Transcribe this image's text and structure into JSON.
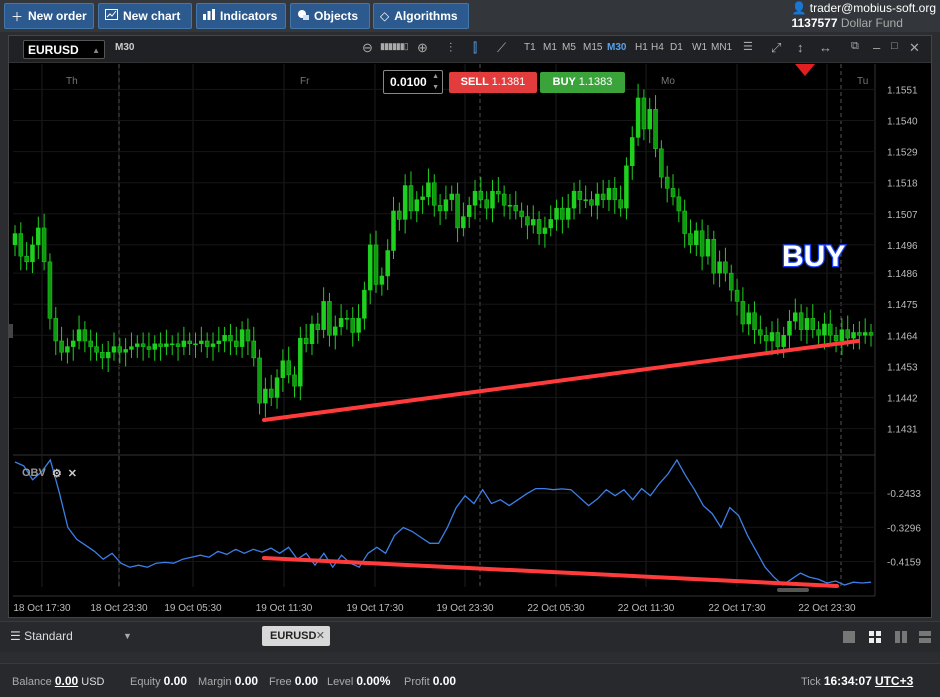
{
  "toolbar": {
    "buttons": [
      {
        "label": "New order",
        "icon": "plus-icon"
      },
      {
        "label": "New chart",
        "icon": "chart-icon"
      },
      {
        "label": "Indicators",
        "icon": "bars-icon"
      },
      {
        "label": "Objects",
        "icon": "objects-icon"
      },
      {
        "label": "Algorithms",
        "icon": "diamond-icon"
      }
    ]
  },
  "account": {
    "user": "trader@mobius-soft.org",
    "number": "1137577",
    "fund": "Dollar Fund"
  },
  "chart": {
    "symbol": "EURUSD",
    "timeframe_badge": "M30",
    "timeframes": [
      "T1",
      "M1",
      "M5",
      "M15",
      "M30",
      "H1",
      "H4",
      "D1",
      "W1",
      "MN1"
    ],
    "active_timeframe": "M30",
    "volume": "0.0100",
    "sell": {
      "label": "SELL",
      "price": "1.1381"
    },
    "buy": {
      "label": "BUY",
      "price": "1.1383"
    },
    "annotation": "BUY",
    "indicator": "OBV",
    "colors": {
      "bull": "#1fd11f",
      "bear": "#0f9a0f",
      "trendline": "#ff3b3b",
      "obv": "#3d7fe6",
      "buy_text": "#ffffff",
      "buy_glow": "#1a45ff"
    }
  },
  "chart_data": {
    "type": "candlestick",
    "price_ticks": [
      1.1551,
      1.154,
      1.1529,
      1.1518,
      1.1507,
      1.1496,
      1.1486,
      1.1475,
      1.1464,
      1.1453,
      1.1442,
      1.1431
    ],
    "obv_ticks": [
      -0.2433,
      -0.3296,
      -0.4159
    ],
    "day_labels": [
      "Th",
      "Fr",
      "Mo",
      "Tu"
    ],
    "time_labels": [
      "18 Oct 17:30",
      "18 Oct 23:30",
      "19 Oct 05:30",
      "19 Oct 11:30",
      "19 Oct 17:30",
      "19 Oct 23:30",
      "22 Oct 05:30",
      "22 Oct 11:30",
      "22 Oct 17:30",
      "22 Oct 23:30"
    ],
    "close": [
      1.15,
      1.1492,
      1.149,
      1.1496,
      1.1502,
      1.149,
      1.147,
      1.1462,
      1.1458,
      1.146,
      1.1462,
      1.1466,
      1.1462,
      1.146,
      1.1458,
      1.1456,
      1.1458,
      1.146,
      1.1458,
      1.1459,
      1.146,
      1.1461,
      1.146,
      1.1459,
      1.1461,
      1.146,
      1.1461,
      1.1461,
      1.146,
      1.1462,
      1.1461,
      1.1461,
      1.1462,
      1.146,
      1.1461,
      1.1462,
      1.1464,
      1.1462,
      1.146,
      1.1466,
      1.1462,
      1.1456,
      1.144,
      1.1445,
      1.1442,
      1.1449,
      1.1455,
      1.145,
      1.1446,
      1.1463,
      1.1461,
      1.1468,
      1.1466,
      1.1476,
      1.1464,
      1.1467,
      1.147,
      1.147,
      1.1465,
      1.147,
      1.148,
      1.1496,
      1.1482,
      1.1485,
      1.1494,
      1.1508,
      1.1505,
      1.1517,
      1.1508,
      1.1512,
      1.1513,
      1.1518,
      1.151,
      1.1508,
      1.1512,
      1.1514,
      1.1502,
      1.1506,
      1.151,
      1.1515,
      1.1512,
      1.1509,
      1.1515,
      1.1514,
      1.151,
      1.151,
      1.1508,
      1.1506,
      1.1503,
      1.1505,
      1.15,
      1.1502,
      1.1505,
      1.1509,
      1.1505,
      1.1509,
      1.1515,
      1.1512,
      1.1512,
      1.151,
      1.1514,
      1.1512,
      1.1516,
      1.1512,
      1.1509,
      1.1524,
      1.1534,
      1.1548,
      1.1537,
      1.1544,
      1.153,
      1.152,
      1.1516,
      1.1513,
      1.1508,
      1.15,
      1.1496,
      1.1501,
      1.1492,
      1.1498,
      1.1486,
      1.149,
      1.1486,
      1.148,
      1.1476,
      1.1468,
      1.1472,
      1.1466,
      1.1464,
      1.1462,
      1.1465,
      1.146,
      1.1464,
      1.1469,
      1.1472,
      1.1466,
      1.147,
      1.1466,
      1.1464,
      1.1468,
      1.1464,
      1.1462,
      1.1466,
      1.1463,
      1.1465,
      1.1464,
      1.1465,
      1.1464
    ],
    "obv": [
      -0.165,
      -0.175,
      -0.21,
      -0.19,
      -0.16,
      -0.24,
      -0.33,
      -0.36,
      -0.375,
      -0.39,
      -0.41,
      -0.395,
      -0.42,
      -0.43,
      -0.425,
      -0.43,
      -0.42,
      -0.418,
      -0.42,
      -0.41,
      -0.405,
      -0.4,
      -0.405,
      -0.39,
      -0.398,
      -0.385,
      -0.395,
      -0.385,
      -0.392,
      -0.382,
      -0.395,
      -0.38,
      -0.41,
      -0.395,
      -0.425,
      -0.395,
      -0.43,
      -0.4,
      -0.42,
      -0.43,
      -0.395,
      -0.38,
      -0.395,
      -0.35,
      -0.33,
      -0.34,
      -0.355,
      -0.37,
      -0.37,
      -0.33,
      -0.28,
      -0.25,
      -0.27,
      -0.235,
      -0.27,
      -0.26,
      -0.275,
      -0.26,
      -0.245,
      -0.232,
      -0.232,
      -0.235,
      -0.233,
      -0.235,
      -0.255,
      -0.275,
      -0.258,
      -0.235,
      -0.25,
      -0.235,
      -0.26,
      -0.232,
      -0.25,
      -0.22,
      -0.195,
      -0.16,
      -0.2,
      -0.235,
      -0.275,
      -0.295,
      -0.33,
      -0.28,
      -0.3,
      -0.35,
      -0.39,
      -0.43,
      -0.455,
      -0.475,
      -0.46,
      -0.445,
      -0.455,
      -0.46,
      -0.47,
      -0.465,
      -0.475,
      -0.468,
      -0.47,
      -0.468
    ]
  },
  "tabs": {
    "workspace": "Standard",
    "symbol_tab": "EURUSD"
  },
  "status": {
    "balance_label": "Balance",
    "balance": "0.00",
    "currency": "USD",
    "equity_label": "Equity",
    "equity": "0.00",
    "margin_label": "Margin",
    "margin": "0.00",
    "free_label": "Free",
    "free": "0.00",
    "level_label": "Level",
    "level": "0.00%",
    "profit_label": "Profit",
    "profit": "0.00",
    "tick_label": "Tick",
    "time": "16:34:07",
    "tz": "UTC+3"
  }
}
